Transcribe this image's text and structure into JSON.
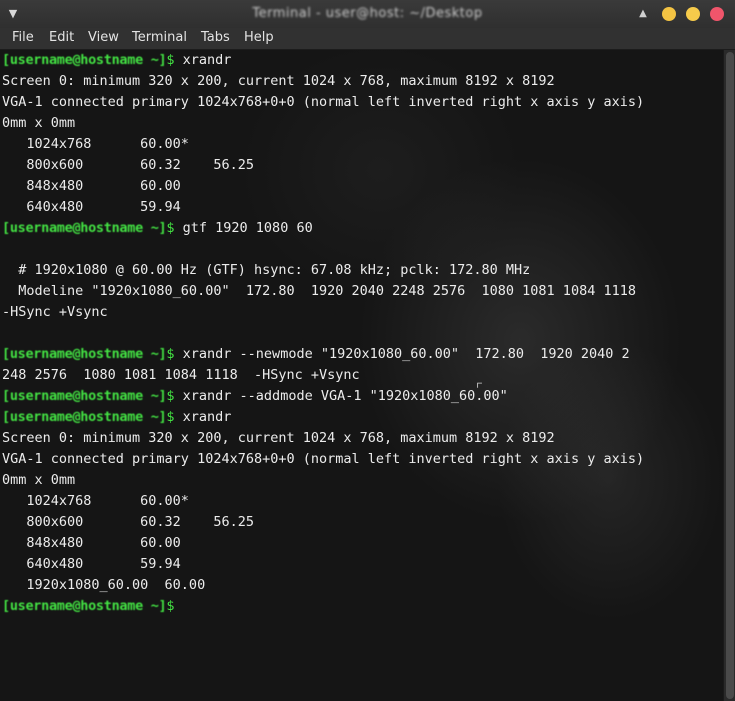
{
  "window": {
    "title": "Terminal - user@host: ~/Desktop",
    "menu": [
      "File",
      "Edit",
      "View",
      "Terminal",
      "Tabs",
      "Help"
    ]
  },
  "terminal": {
    "prompt_user": "[username@hostname ~]",
    "lines": [
      {
        "type": "prompt",
        "cmd": "xrandr"
      },
      {
        "type": "out",
        "text": "Screen 0: minimum 320 x 200, current 1024 x 768, maximum 8192 x 8192"
      },
      {
        "type": "out",
        "text": "VGA-1 connected primary 1024x768+0+0 (normal left inverted right x axis y axis)"
      },
      {
        "type": "out",
        "text": "0mm x 0mm"
      },
      {
        "type": "out",
        "text": "   1024x768      60.00*"
      },
      {
        "type": "out",
        "text": "   800x600       60.32    56.25"
      },
      {
        "type": "out",
        "text": "   848x480       60.00"
      },
      {
        "type": "out",
        "text": "   640x480       59.94"
      },
      {
        "type": "prompt",
        "cmd": "gtf 1920 1080 60"
      },
      {
        "type": "out",
        "text": ""
      },
      {
        "type": "out",
        "text": "  # 1920x1080 @ 60.00 Hz (GTF) hsync: 67.08 kHz; pclk: 172.80 MHz"
      },
      {
        "type": "out",
        "text": "  Modeline \"1920x1080_60.00\"  172.80  1920 2040 2248 2576  1080 1081 1084 1118"
      },
      {
        "type": "out",
        "text": "-HSync +Vsync"
      },
      {
        "type": "out",
        "text": ""
      },
      {
        "type": "prompt",
        "cmd": "xrandr --newmode \"1920x1080_60.00\"  172.80  1920 2040 2"
      },
      {
        "type": "out",
        "text": "248 2576  1080 1081 1084 1118  -HSync +Vsync"
      },
      {
        "type": "prompt",
        "cmd": "xrandr --addmode VGA-1 \"1920x1080_60.00\""
      },
      {
        "type": "prompt",
        "cmd": "xrandr"
      },
      {
        "type": "out",
        "text": "Screen 0: minimum 320 x 200, current 1024 x 768, maximum 8192 x 8192"
      },
      {
        "type": "out",
        "text": "VGA-1 connected primary 1024x768+0+0 (normal left inverted right x axis y axis)"
      },
      {
        "type": "out",
        "text": "0mm x 0mm"
      },
      {
        "type": "out",
        "text": "   1024x768      60.00*"
      },
      {
        "type": "out",
        "text": "   800x600       60.32    56.25"
      },
      {
        "type": "out",
        "text": "   848x480       60.00"
      },
      {
        "type": "out",
        "text": "   640x480       59.94"
      },
      {
        "type": "out",
        "text": "   1920x1080_60.00  60.00"
      },
      {
        "type": "prompt",
        "cmd": ""
      }
    ]
  },
  "colors": {
    "prompt_green": "#43e243",
    "text": "#ececec",
    "close": "#f0556b",
    "minimize": "#f3c343"
  }
}
